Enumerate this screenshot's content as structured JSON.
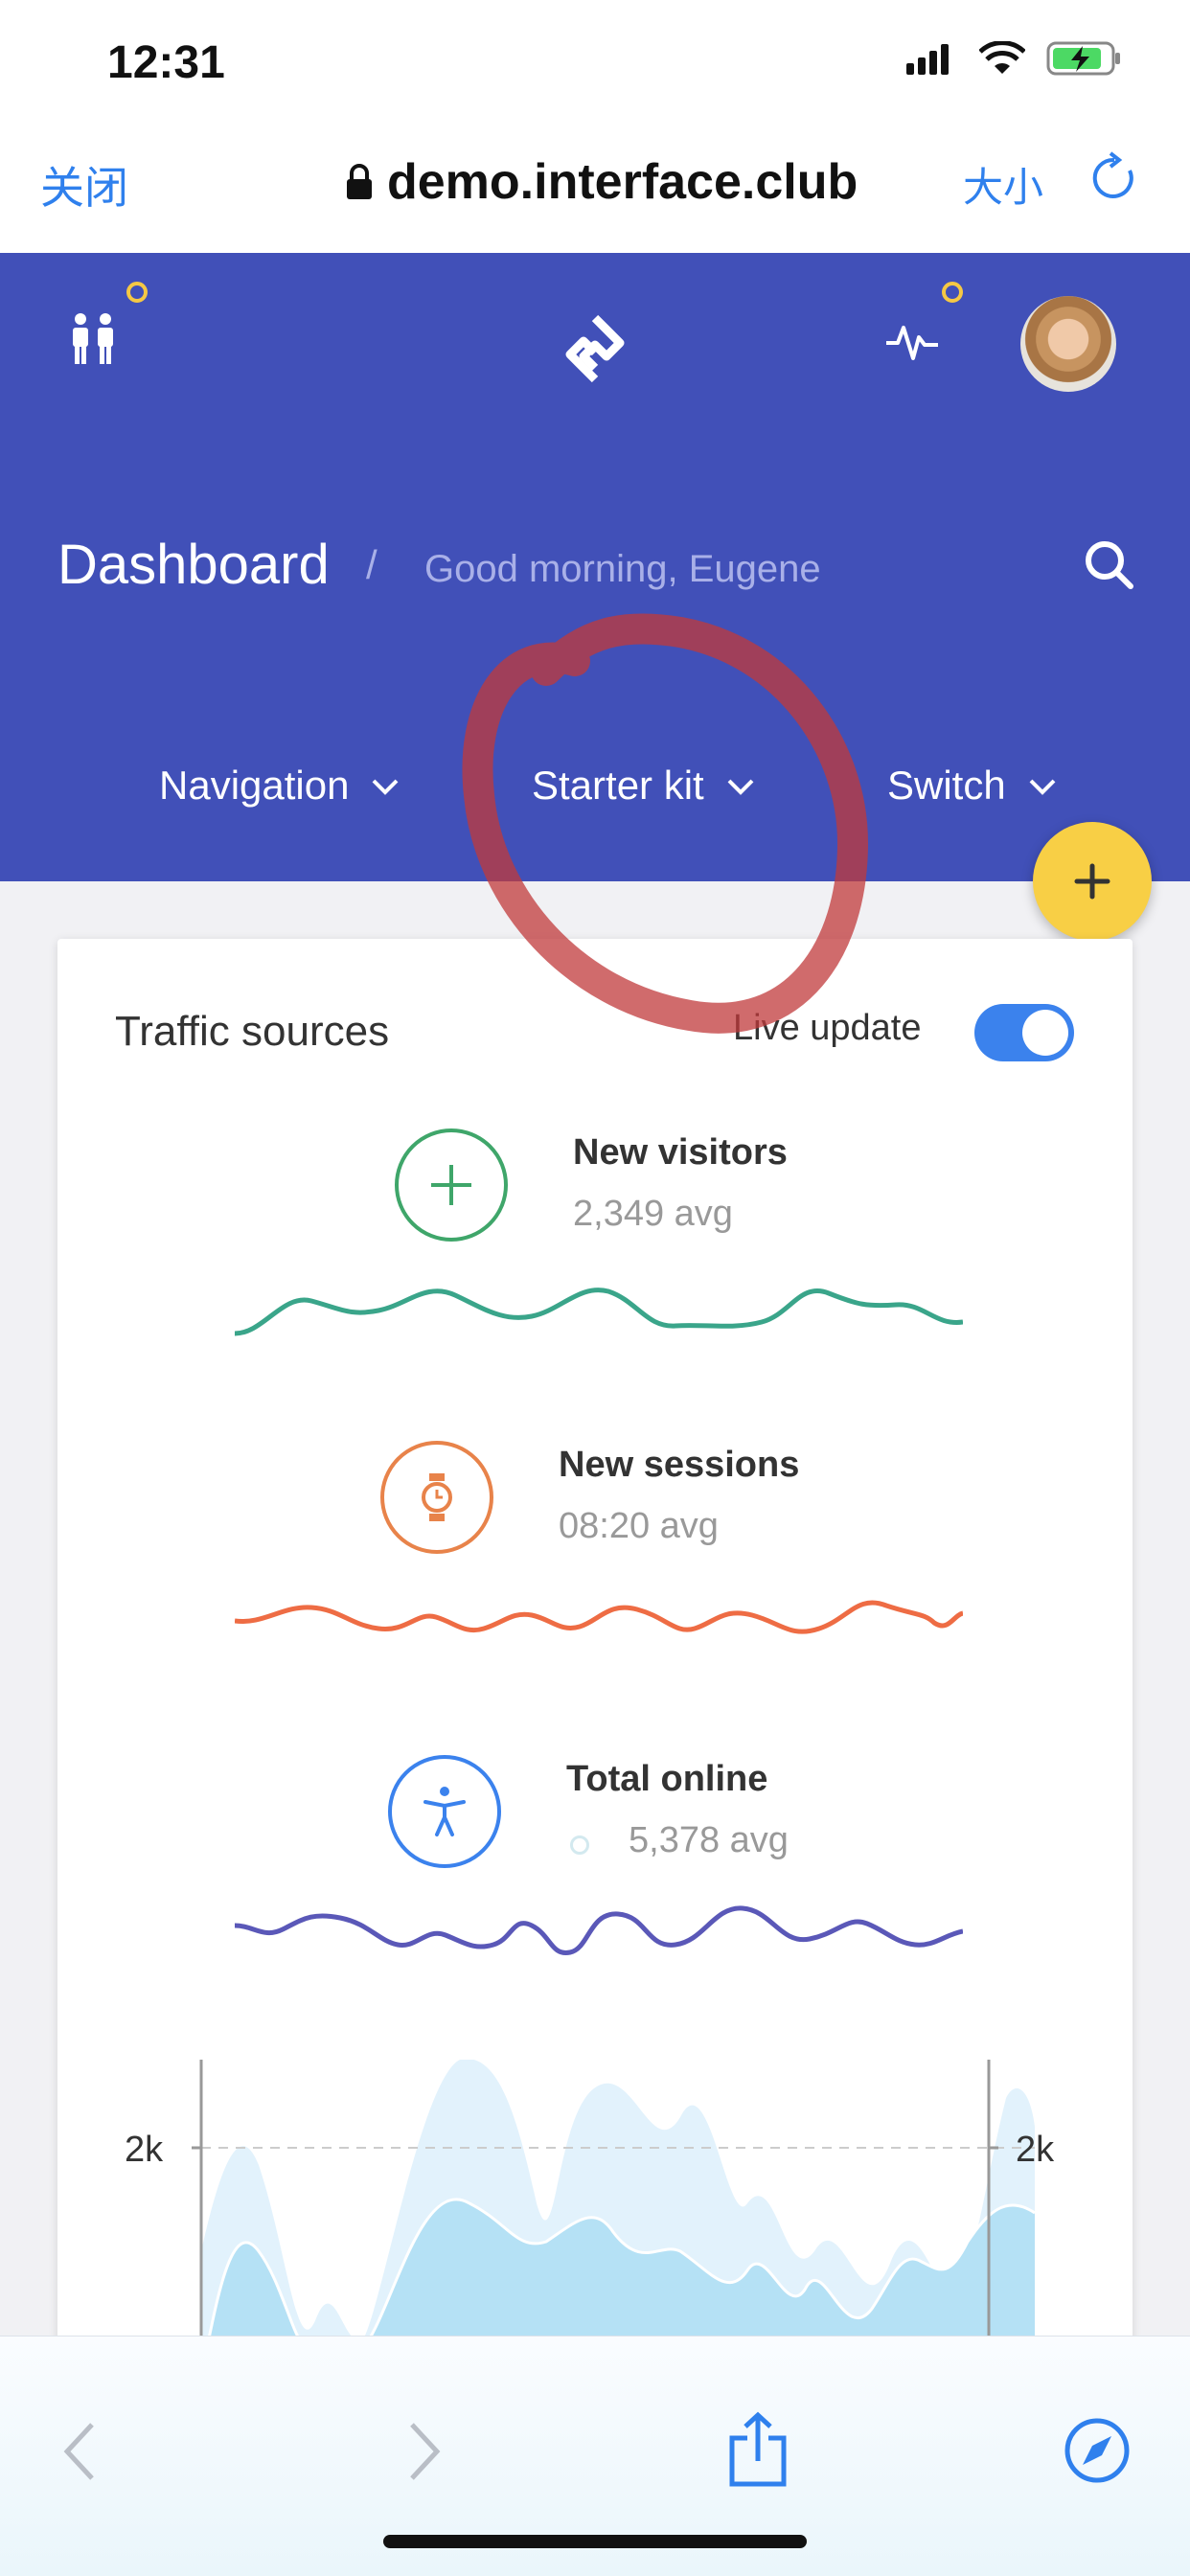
{
  "status_bar": {
    "time": "12:31"
  },
  "browser": {
    "close_label": "关闭",
    "url": "demo.interface.club",
    "size_label": "大小"
  },
  "header": {
    "title": "Dashboard",
    "separator": "/",
    "greeting": "Good morning, Eugene",
    "nav_items": [
      {
        "label": "Navigation"
      },
      {
        "label": "Starter kit"
      },
      {
        "label": "Switch"
      }
    ]
  },
  "card": {
    "title": "Traffic sources",
    "live_update_label": "Live update",
    "live_update_on": true,
    "metrics": [
      {
        "title": "New visitors",
        "value": "2,349 avg",
        "icon": "plus-icon",
        "color": "#3fa66a",
        "line_color": "#3aa58a"
      },
      {
        "title": "New sessions",
        "value": "08:20 avg",
        "icon": "clock-icon",
        "color": "#e8834a",
        "line_color": "#ee6c44"
      },
      {
        "title": "Total online",
        "value": "5,378 avg",
        "icon": "accessibility-icon",
        "color": "#3b82ed",
        "line_color": "#5a58b8"
      }
    ],
    "chart": {
      "left_tick": "2k",
      "right_tick": "2k"
    }
  },
  "colors": {
    "header_bg": "#4150b8",
    "fab": "#f8cf45",
    "accent": "#2f80ed",
    "annotation": "#c0393b"
  }
}
